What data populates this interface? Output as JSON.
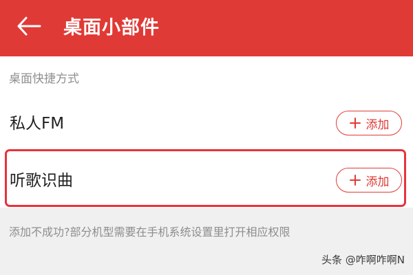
{
  "header": {
    "title": "桌面小部件",
    "back_icon": "arrow-left-icon",
    "background_color": "#e03a36"
  },
  "section": {
    "title": "桌面快捷方式"
  },
  "items": [
    {
      "label": "私人FM",
      "button_label": "添加",
      "button_icon": "plus-icon"
    },
    {
      "label": "听歌识曲",
      "button_label": "添加",
      "button_icon": "plus-icon"
    }
  ],
  "footer": {
    "note": "添加不成功?部分机型需要在手机系统设置里打开相应权限"
  },
  "watermark": {
    "text": "头条 @咋啊咋啊N"
  },
  "colors": {
    "accent": "#e03a36",
    "highlight": "#e8323c",
    "background": "#f0f0f0"
  }
}
